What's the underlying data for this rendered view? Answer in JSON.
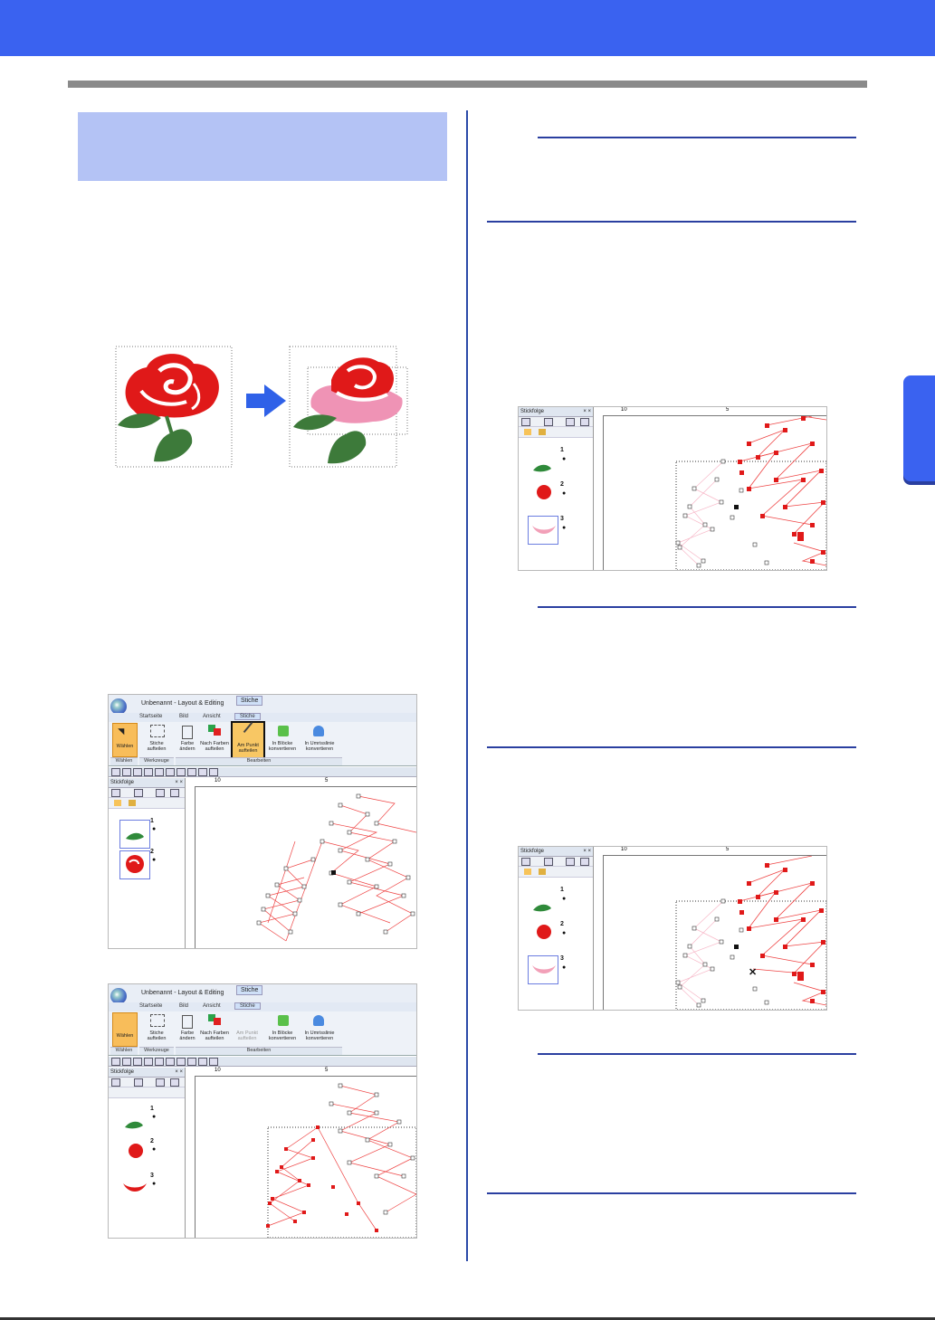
{
  "colors": {
    "header": "#3a62f0",
    "section_box": "#b4c3f5",
    "rule": "#2a3fa0",
    "stitch_red": "#e21010",
    "stitch_pink": "#f2a0b8"
  },
  "icons": [
    "rose-red-image",
    "rose-pink-image",
    "arrow-right-icon",
    "eye-icon",
    "app-orb-icon"
  ],
  "screenshot_top": {
    "title": "Unbenannt - Layout & Editing",
    "context_tab": "Stiche",
    "tabs": [
      "Startseite",
      "Bild",
      "Ansicht",
      "Stiche"
    ],
    "buttons": {
      "select": "Wählen",
      "split_stitches": [
        "Stiche",
        "aufteilen"
      ],
      "color_change": [
        "Farbe",
        "ändern"
      ],
      "split_by_color": [
        "Nach Farben",
        "aufteilen"
      ],
      "split_at_point": [
        "Am Punkt",
        "aufteilen"
      ],
      "to_blocks": [
        "In Blöcke",
        "konvertieren"
      ],
      "to_outline": [
        "In Umrisslinie",
        "konvertieren"
      ]
    },
    "groups": [
      "Wählen",
      "Werkzeuge",
      "Bearbeiten"
    ],
    "panel_title": "Stickfolge",
    "panel_close": "× ×",
    "items": [
      "1",
      "2"
    ],
    "ruler_labels": [
      "10",
      "5"
    ]
  },
  "screenshot_bottom": {
    "title": "Unbenannt - Layout & Editing",
    "context_tab": "Stiche",
    "tabs": [
      "Startseite",
      "Bild",
      "Ansicht",
      "Stiche"
    ],
    "buttons": {
      "select": "Wählen",
      "split_stitches": [
        "Stiche",
        "aufteilen"
      ],
      "color_change": [
        "Farbe",
        "ändern"
      ],
      "split_by_color": [
        "Nach Farben",
        "aufteilen"
      ],
      "split_at_point": [
        "Am Punkt",
        "aufteilen"
      ],
      "to_blocks": [
        "In Blöcke",
        "konvertieren"
      ],
      "to_outline": [
        "In Umrisslinie",
        "konvertieren"
      ]
    },
    "groups": [
      "Wählen",
      "Werkzeuge",
      "Bearbeiten"
    ],
    "panel_title": "Stickfolge",
    "panel_close": "× ×",
    "items": [
      "1",
      "2",
      "3"
    ],
    "ruler_labels": [
      "10",
      "5"
    ]
  },
  "screenshot_right_a": {
    "panel_title": "Stickfolge",
    "panel_close": "× ×",
    "items": [
      "1",
      "2",
      "3"
    ],
    "ruler_labels": [
      "10",
      "5"
    ]
  },
  "screenshot_right_b": {
    "panel_title": "Stickfolge",
    "panel_close": "× ×",
    "items": [
      "1",
      "2",
      "3"
    ],
    "ruler_labels": [
      "10",
      "5"
    ],
    "cursor_mark": "✕"
  }
}
